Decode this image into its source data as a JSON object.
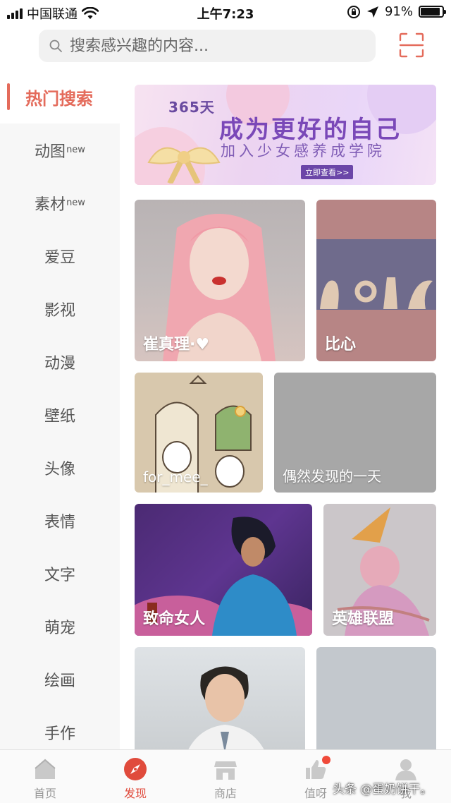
{
  "status_bar": {
    "carrier": "中国联通",
    "time": "上午7:23",
    "battery": "91%",
    "battery_level": 0.91
  },
  "search": {
    "placeholder": "搜索感兴趣的内容..."
  },
  "sidebar": {
    "items": [
      {
        "label": "热门搜索",
        "badge": ""
      },
      {
        "label": "动图",
        "badge": "new"
      },
      {
        "label": "素材",
        "badge": "new"
      },
      {
        "label": "爱豆",
        "badge": ""
      },
      {
        "label": "影视",
        "badge": ""
      },
      {
        "label": "动漫",
        "badge": ""
      },
      {
        "label": "壁纸",
        "badge": ""
      },
      {
        "label": "头像",
        "badge": ""
      },
      {
        "label": "表情",
        "badge": ""
      },
      {
        "label": "文字",
        "badge": ""
      },
      {
        "label": "萌宠",
        "badge": ""
      },
      {
        "label": "绘画",
        "badge": ""
      },
      {
        "label": "手作",
        "badge": ""
      }
    ]
  },
  "banner": {
    "days": "365天",
    "title": "成为更好的自己",
    "subtitle": "加入少女感养成学院",
    "button": "立即查看>>"
  },
  "tiles": [
    {
      "label": "崔真理·♥"
    },
    {
      "label": "比心"
    },
    {
      "label": "for_mee_"
    },
    {
      "label": "偶然发现的一天"
    },
    {
      "label": "致命女人"
    },
    {
      "label": "英雄联盟"
    },
    {
      "label": ""
    },
    {
      "label": ""
    }
  ],
  "tab_bar": {
    "tabs": [
      {
        "label": "首页",
        "icon": "home-icon"
      },
      {
        "label": "发现",
        "icon": "compass-icon"
      },
      {
        "label": "商店",
        "icon": "store-icon"
      },
      {
        "label": "值呀",
        "icon": "thumbs-up-icon"
      },
      {
        "label": "我",
        "icon": "user-icon"
      }
    ]
  },
  "watermark": "头条 @蛋奶饼干。",
  "colors": {
    "accent": "#e46b5b",
    "tab_active": "#e04b3c"
  }
}
